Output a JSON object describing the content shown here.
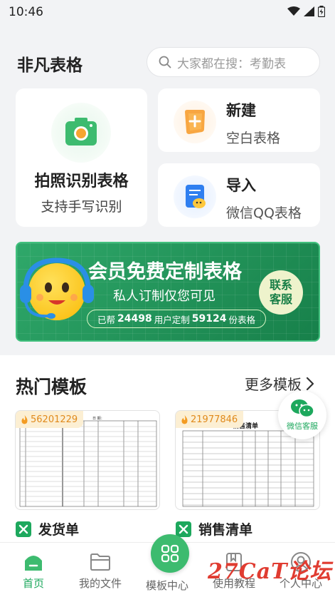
{
  "status_bar": {
    "time": "10:46"
  },
  "header": {
    "app_title": "非凡表格",
    "search_placeholder": "大家都在搜：考勤表"
  },
  "quick_actions": {
    "photo": {
      "title": "拍照识别表格",
      "subtitle": "支持手写识别"
    },
    "new": {
      "title": "新建",
      "subtitle": "空白表格"
    },
    "import": {
      "title": "导入",
      "subtitle": "微信QQ表格"
    }
  },
  "banner": {
    "title": "会员免费定制表格",
    "subtitle": "私人订制仅您可见",
    "stats_prefix": "已帮",
    "users_count": "24498",
    "stats_middle": "用户定制",
    "forms_count": "59124",
    "stats_suffix": "份表格",
    "contact_line1": "联系",
    "contact_line2": "客服"
  },
  "hot_templates": {
    "title": "热门模板",
    "more_label": "更多模板",
    "items": [
      {
        "badge": "56201229",
        "name": "发货单",
        "sheet_title": "日 期："
      },
      {
        "badge": "21977846",
        "name": "销售清单",
        "sheet_title": "销售清单"
      }
    ]
  },
  "float_service": {
    "label": "微信客服"
  },
  "bottom_nav": {
    "items": [
      {
        "label": "首页"
      },
      {
        "label": "我的文件"
      },
      {
        "label": "模板中心"
      },
      {
        "label": "使用教程"
      },
      {
        "label": "个人中心"
      }
    ]
  },
  "watermark": {
    "text": "27CaT论坛"
  },
  "colors": {
    "accent": "#1da85d",
    "banner": "#1f8f55",
    "badge": "#e08a1c",
    "watermark": "#e03c31"
  }
}
